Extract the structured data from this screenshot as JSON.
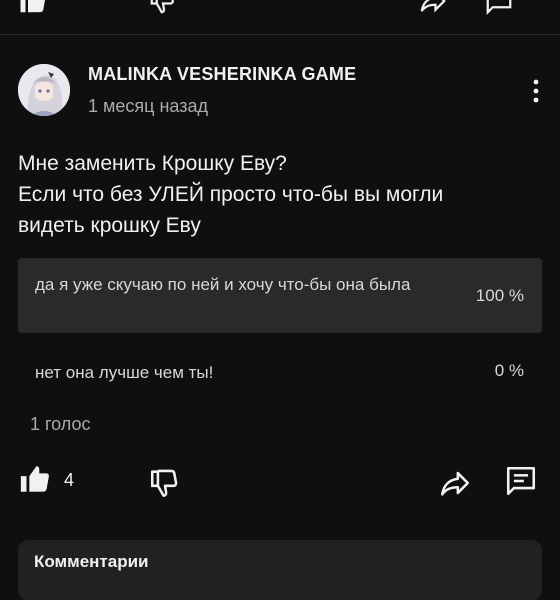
{
  "post": {
    "channel_name": "MALINKA VESHERINKA GAME",
    "timestamp": "1 месяц назад",
    "text_lines": [
      "Мне заменить Крошку Еву?",
      "Если что без УЛЕЙ просто что-бы вы могли",
      "видеть крошку Еву"
    ]
  },
  "poll": {
    "options": [
      {
        "label": "да я уже скучаю по ней и хочу что-бы она была",
        "percent": "100 %"
      },
      {
        "label": "нет она лучше чем ты!",
        "percent": "0 %"
      }
    ],
    "votes_label": "1 голос"
  },
  "actions": {
    "like_count": "4",
    "icons": [
      "like-icon",
      "dislike-icon",
      "share-icon",
      "comment-icon",
      "more-vertical-icon"
    ]
  },
  "comments": {
    "title": "Комментарии"
  },
  "colors": {
    "background": "#0f0f0f",
    "text": "#f1f1f1",
    "secondary_text": "#aaaaaa",
    "poll_selected_bg": "#2a2a2a",
    "comments_card_bg": "#212121"
  }
}
